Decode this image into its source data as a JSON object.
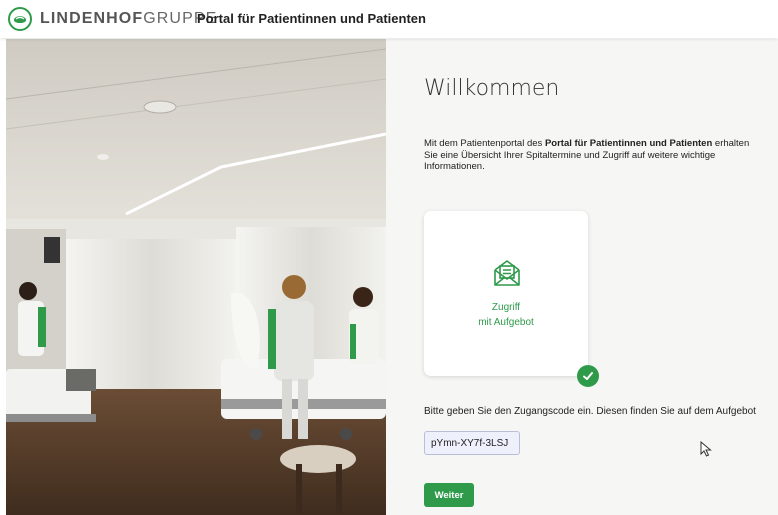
{
  "header": {
    "logo_bold": "LINDENHOF",
    "logo_light": "GRUPPE",
    "portal_title": "Portal für Patientinnen und Patienten",
    "logo_icon": "lindenhof-logo-icon",
    "brand_color": "#2e9a4a"
  },
  "main": {
    "welcome": "Willkommen",
    "intro_prefix": "Mit dem Patientenportal des ",
    "intro_bold": "Portal für Patientinnen und Patienten",
    "intro_suffix": " erhalten Sie eine Übersicht Ihrer Spitaltermine und Zugriff auf weitere wichtige Informationen.",
    "access_card": {
      "line1": "Zugriff",
      "line2": "mit Aufgebot",
      "icon": "envelope-document-icon",
      "selected": true
    },
    "instruction": "Bitte geben Sie den Zugangscode ein. Diesen finden Sie auf dem Aufgebot",
    "access_code": "pYmn-XY7f-3LSJ",
    "submit_label": "Weiter"
  },
  "photo": {
    "subject": "hospital-room-photo"
  }
}
